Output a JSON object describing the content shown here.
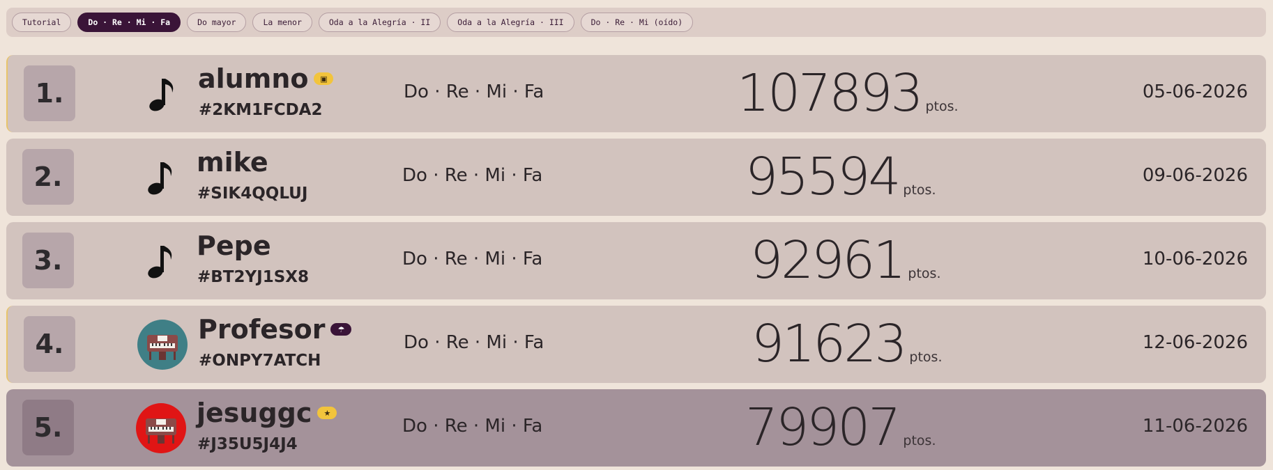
{
  "tabs": [
    {
      "label": "Tutorial",
      "active": false
    },
    {
      "label": "Do · Re · Mi · Fa",
      "active": true
    },
    {
      "label": "Do mayor",
      "active": false
    },
    {
      "label": "La menor",
      "active": false
    },
    {
      "label": "Oda a la Alegría · II",
      "active": false
    },
    {
      "label": "Oda a la Alegría · III",
      "active": false
    },
    {
      "label": "Do · Re · Mi (oído)",
      "active": false
    }
  ],
  "leaderboard": [
    {
      "rank": "1.",
      "name": "alumno",
      "badge": "student-badge-icon",
      "code": "#2KM1FCDA2",
      "level": "Do · Re · Mi · Fa",
      "score": "107893",
      "unit": "ptos.",
      "date": "05-06-2026",
      "avatar": "music-note-icon"
    },
    {
      "rank": "2.",
      "name": "mike",
      "badge": "",
      "code": "#SIK4QQLUJ",
      "level": "Do · Re · Mi · Fa",
      "score": "95594",
      "unit": "ptos.",
      "date": "09-06-2026",
      "avatar": "music-note-icon"
    },
    {
      "rank": "3.",
      "name": "Pepe",
      "badge": "",
      "code": "#BT2YJ1SX8",
      "level": "Do · Re · Mi · Fa",
      "score": "92961",
      "unit": "ptos.",
      "date": "10-06-2026",
      "avatar": "music-note-icon"
    },
    {
      "rank": "4.",
      "name": "Profesor",
      "badge": "teacher-badge-icon",
      "code": "#ONPY7ATCH",
      "level": "Do · Re · Mi · Fa",
      "score": "91623",
      "unit": "ptos.",
      "date": "12-06-2026",
      "avatar": "piano-teal-avatar"
    },
    {
      "rank": "5.",
      "name": "jesuggc",
      "badge": "star-badge-icon",
      "code": "#J35U5J4J4",
      "level": "Do · Re · Mi · Fa",
      "score": "79907",
      "unit": "ptos.",
      "date": "11-06-2026",
      "avatar": "piano-red-avatar"
    }
  ],
  "colors": {
    "accent": "#3a1438",
    "badge_yellow": "#f2c43c",
    "avatar_teal": "#3f7f86",
    "avatar_red": "#e01515"
  }
}
